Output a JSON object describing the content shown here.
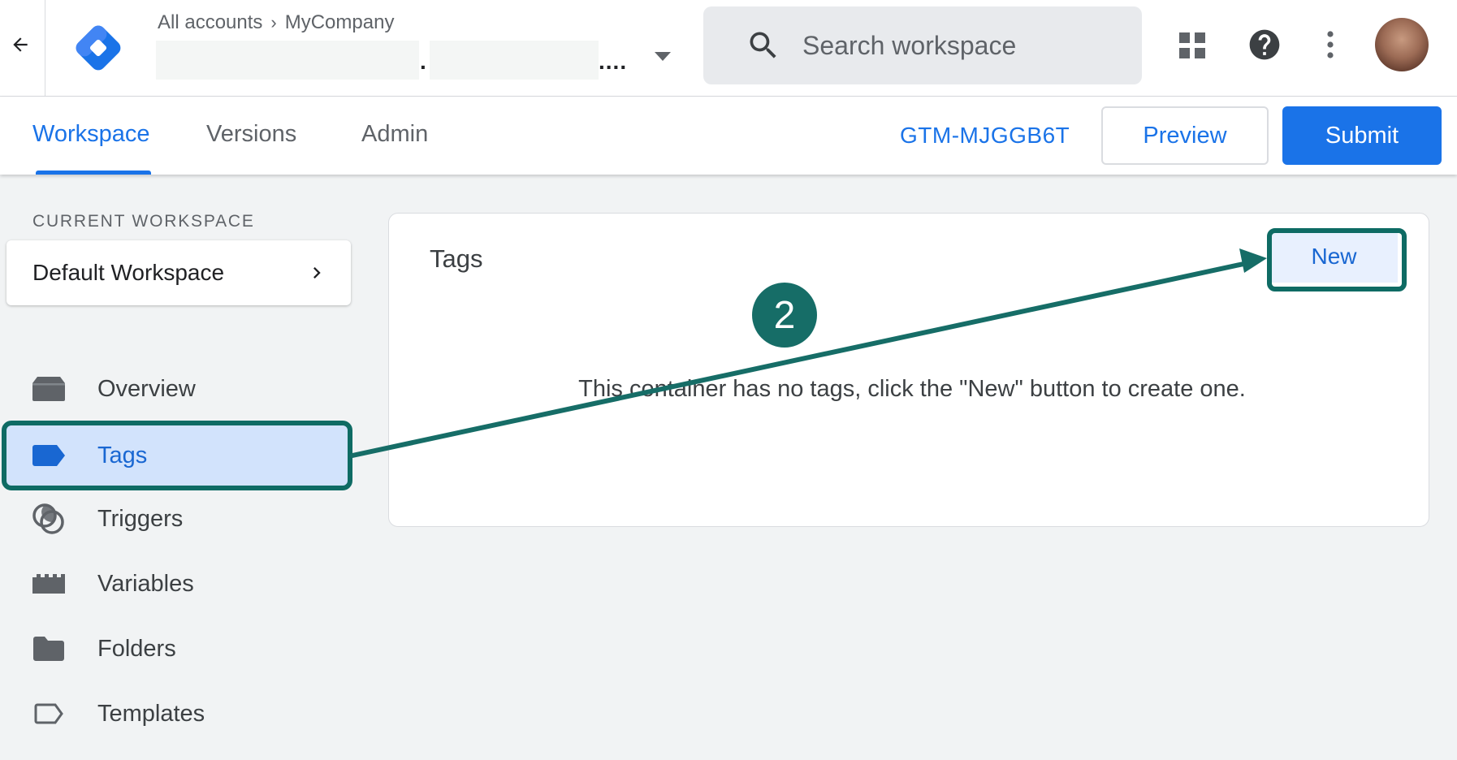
{
  "topbar": {
    "breadcrumb": [
      "All accounts",
      "MyCompany"
    ],
    "search_placeholder": "Search workspace"
  },
  "tabbar": {
    "tabs": [
      "Workspace",
      "Versions",
      "Admin"
    ],
    "active_tab": "Workspace",
    "container_id": "GTM-MJGGB6T",
    "preview_label": "Preview",
    "submit_label": "Submit"
  },
  "sidebar": {
    "current_workspace_label": "CURRENT WORKSPACE",
    "workspace_name": "Default Workspace",
    "items": [
      {
        "label": "Overview",
        "icon": "overview-icon"
      },
      {
        "label": "Tags",
        "icon": "tag-icon",
        "selected": true
      },
      {
        "label": "Triggers",
        "icon": "trigger-icon"
      },
      {
        "label": "Variables",
        "icon": "variables-icon"
      },
      {
        "label": "Folders",
        "icon": "folder-icon"
      },
      {
        "label": "Templates",
        "icon": "template-icon"
      }
    ]
  },
  "main": {
    "card_title": "Tags",
    "new_label": "New",
    "empty_message": "This container has no tags, click the \"New\" button to create one."
  },
  "annotation": {
    "step_number": "2"
  },
  "colors": {
    "accent_blue": "#1a73e8",
    "highlight_teal": "#0e6b64",
    "selected_bg": "#d2e3fc"
  }
}
